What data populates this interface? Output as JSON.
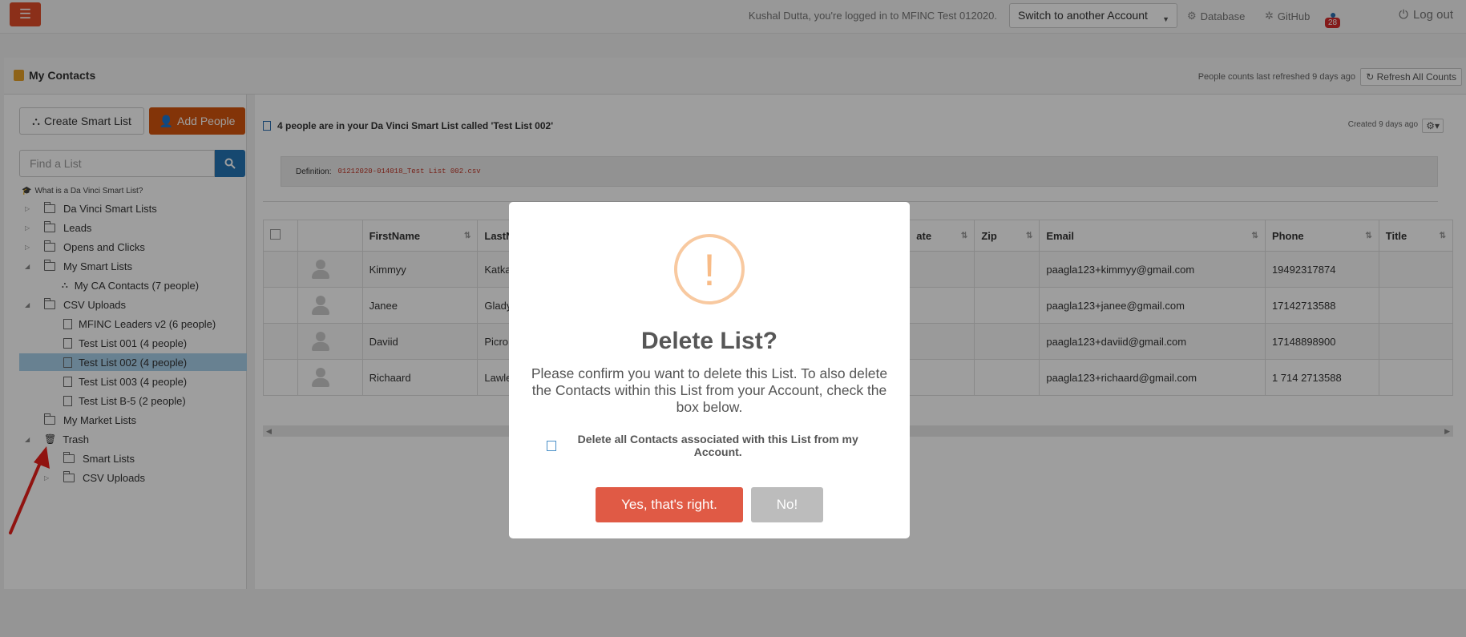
{
  "topbar": {
    "login_text": "Kushal Dutta, you're logged in to MFINC Test 012020.",
    "switch_account": "Switch to another Account",
    "database": "Database",
    "github": "GitHub",
    "notification_count": "28",
    "logout": "Log out"
  },
  "header": {
    "title": "My Contacts",
    "refresh_info": "People counts last refreshed 9 days ago",
    "refresh_button": "Refresh All Counts"
  },
  "sidebar": {
    "create_smart_list": "Create Smart List",
    "add_people": "Add People",
    "find_placeholder": "Find a List",
    "what_is": "What is a Da Vinci Smart List?",
    "tree": [
      {
        "label": "Da Vinci Smart Lists"
      },
      {
        "label": "Leads"
      },
      {
        "label": "Opens and Clicks"
      },
      {
        "label": "My Smart Lists"
      },
      {
        "label": "My CA Contacts (7 people)"
      },
      {
        "label": "CSV Uploads"
      },
      {
        "label": "MFINC Leaders v2 (6 people)"
      },
      {
        "label": "Test List 001 (4 people)"
      },
      {
        "label": "Test List 002 (4 people)"
      },
      {
        "label": "Test List 003 (4 people)"
      },
      {
        "label": "Test List B-5 (2 people)"
      },
      {
        "label": "My Market Lists"
      },
      {
        "label": "Trash"
      },
      {
        "label": "Smart Lists"
      },
      {
        "label": "CSV Uploads"
      }
    ]
  },
  "main": {
    "title": "4 people are in your Da Vinci Smart List called 'Test List 002'",
    "created": "Created 9 days ago",
    "definition_label": "Definition:",
    "definition_value": "01212020-014018_Test List 002.csv",
    "columns": [
      "FirstName",
      "LastN",
      "ate",
      "Zip",
      "Email",
      "Phone",
      "Title"
    ],
    "rows": [
      {
        "first": "Kimmyy",
        "last": "Katka",
        "email": "paagla123+kimmyy@gmail.com",
        "phone": "19492317874"
      },
      {
        "first": "Janee",
        "last": "Glady",
        "email": "paagla123+janee@gmail.com",
        "phone": "17142713588"
      },
      {
        "first": "Daviid",
        "last": "Picro",
        "email": "paagla123+daviid@gmail.com",
        "phone": "17148898900"
      },
      {
        "first": "Richaard",
        "last": "Lawle",
        "email": "paagla123+richaard@gmail.com",
        "phone": "1 714 2713588"
      }
    ]
  },
  "modal": {
    "icon": "!",
    "title": "Delete List?",
    "message": "Please confirm you want to delete this List. To also delete the Contacts within this List from your Account, check the box below.",
    "checkbox_label": "Delete all Contacts associated with this List from my Account.",
    "confirm": "Yes, that's right.",
    "cancel": "No!"
  },
  "colors": {
    "accent_orange": "#d4550d",
    "primary_blue": "#2474b5",
    "confirm_red": "#e05a45",
    "selected_row": "#a9d0ea"
  }
}
